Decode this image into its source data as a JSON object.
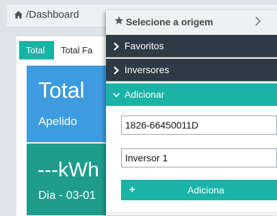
{
  "breadcrumb": {
    "text": "/Dashboard",
    "icon": "home-icon"
  },
  "tabs": [
    {
      "label": "Total",
      "active": true
    },
    {
      "label": "Total Fa",
      "active": false
    }
  ],
  "summary": {
    "title": "Total",
    "subtitle": "Apelido",
    "energy": "---kWh",
    "date": "Dia - 03-01"
  },
  "source_selector": {
    "title": "Selecione a origem",
    "items": [
      {
        "label": "Favoritos",
        "expanded": false
      },
      {
        "label": "Inversores",
        "expanded": false
      },
      {
        "label": "Adicionar",
        "expanded": true
      }
    ],
    "add_form": {
      "serial_value": "1826-66450011D",
      "name_value": "Inversor 1",
      "button_label": "Adiciona"
    }
  },
  "colors": {
    "accent": "#1ab4a6",
    "dark_item": "#2e3a45",
    "blue_panel": "#3d9be0",
    "teal_panel": "#1e9d8c"
  }
}
